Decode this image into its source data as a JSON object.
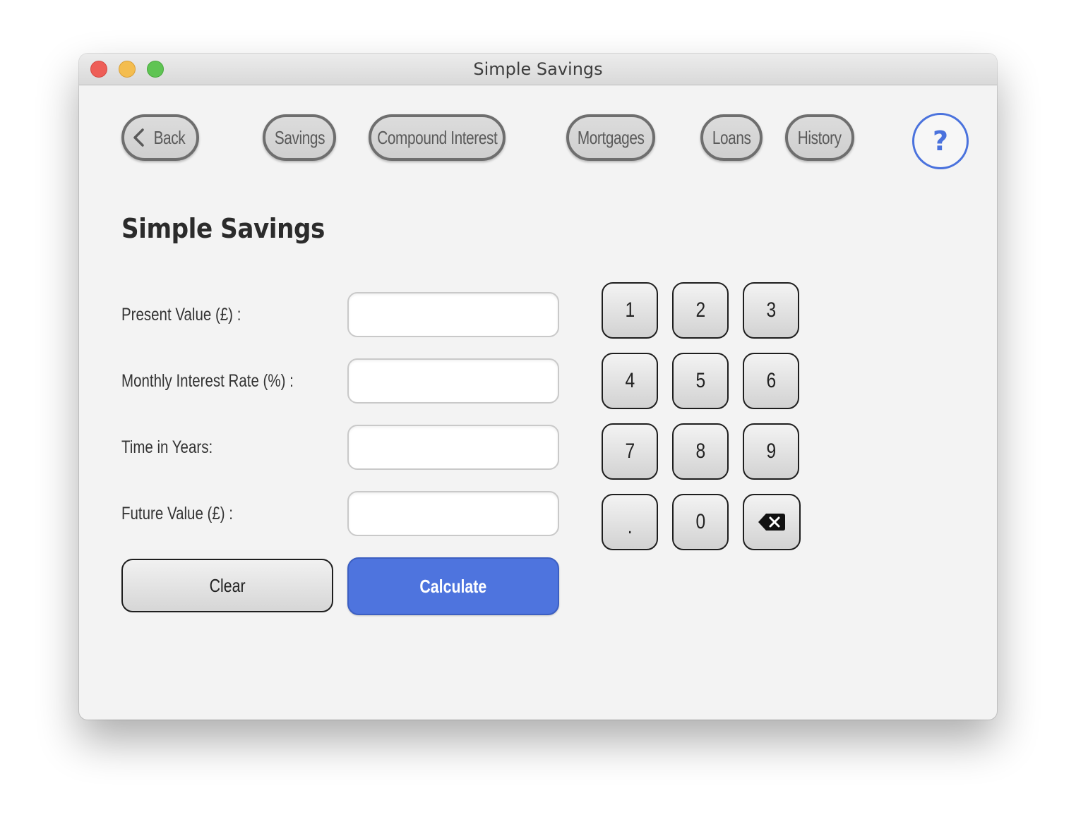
{
  "window": {
    "title": "Simple Savings"
  },
  "nav": {
    "back": "Back",
    "savings": "Savings",
    "compound_interest": "Compound Interest",
    "mortgages": "Mortgages",
    "loans": "Loans",
    "history": "History",
    "help": "?"
  },
  "page": {
    "heading": "Simple Savings"
  },
  "form": {
    "present_value": {
      "label": "Present Value (£) :",
      "value": ""
    },
    "monthly_rate": {
      "label": "Monthly Interest Rate (%) :",
      "value": ""
    },
    "time_years": {
      "label": "Time in Years:",
      "value": ""
    },
    "future_value": {
      "label": "Future Value (£) :",
      "value": ""
    }
  },
  "actions": {
    "clear": "Clear",
    "calculate": "Calculate"
  },
  "keypad": {
    "k1": "1",
    "k2": "2",
    "k3": "3",
    "k4": "4",
    "k5": "5",
    "k6": "6",
    "k7": "7",
    "k8": "8",
    "k9": "9",
    "kdot": ".",
    "k0": "0",
    "backspace_icon": "backspace-icon"
  },
  "colors": {
    "accent": "#4e74de",
    "nav_border": "#6e6e6e",
    "help": "#4a72dd"
  }
}
